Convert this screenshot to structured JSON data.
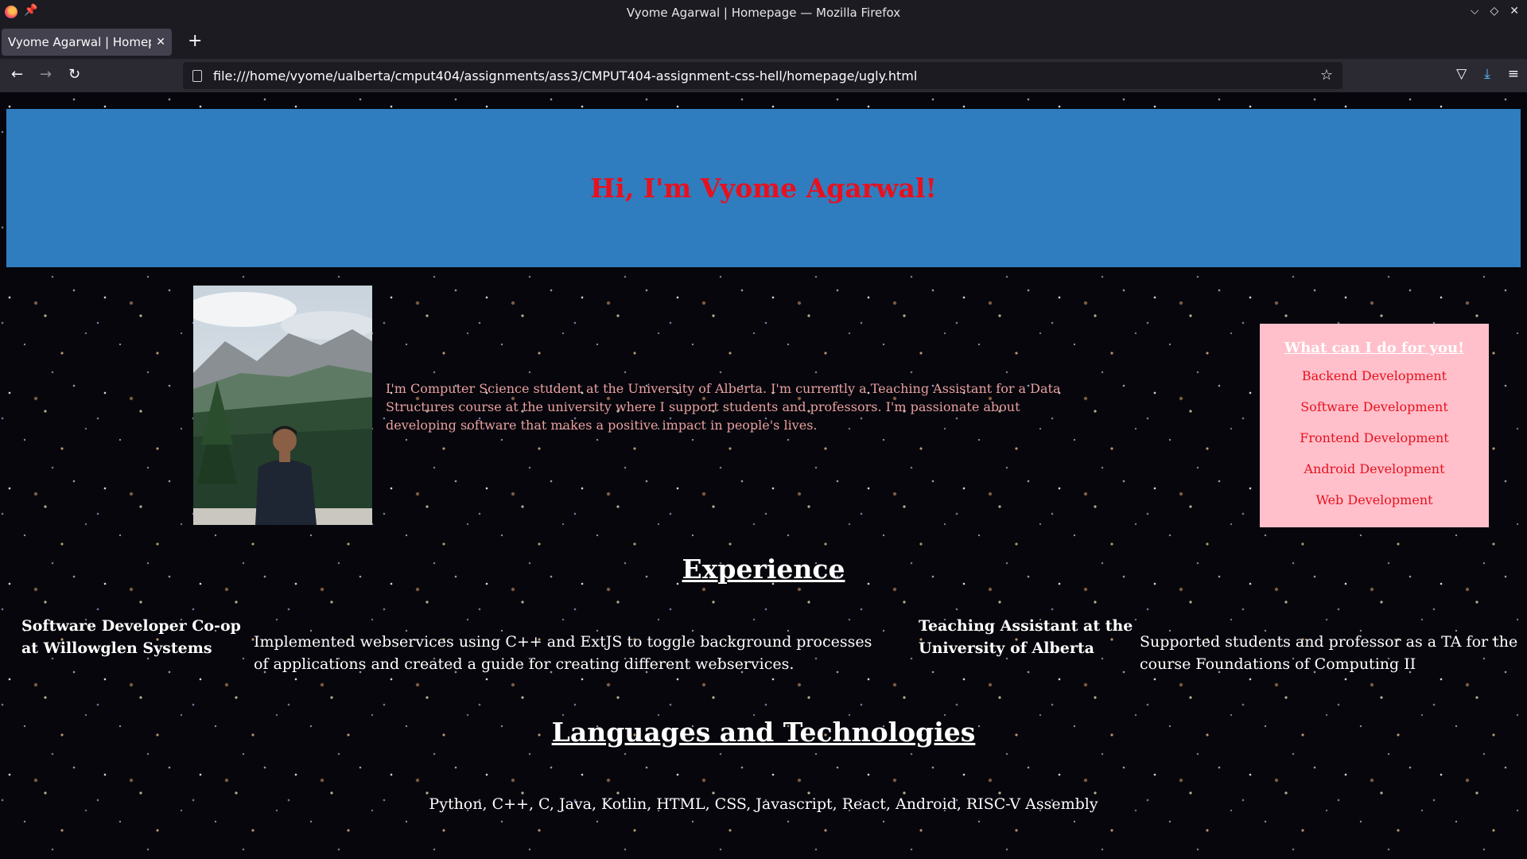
{
  "browser": {
    "window_title": "Vyome Agarwal | Homepage — Mozilla Firefox",
    "tab_title": "Vyome Agarwal | Homepage",
    "url": "file:///home/vyome/ualberta/cmput404/assignments/ass3/CMPUT404-assignment-css-hell/homepage/ugly.html"
  },
  "hero": {
    "heading": "Hi, I'm Vyome Agarwal!",
    "background_color": "#2f7dbf",
    "heading_color": "#e8101e"
  },
  "about": {
    "bio": "I'm Computer Science student at the University of Alberta. I'm currently a Teaching Assistant for a Data Structures course at the university where I support students and professors. I'm passionate about developing software that makes a positive impact in people's lives."
  },
  "services": {
    "title": "What can I do for you!",
    "items": [
      "Backend Development",
      "Software Development",
      "Frontend Development",
      "Android Development",
      "Web Development"
    ],
    "background_color": "#ffc0cb"
  },
  "experience": {
    "title": "Experience",
    "jobs": [
      {
        "role": "Software Developer Co-op at Willowglen Systems",
        "description": "Implemented webservices using C++ and ExtJS to toggle background processes of applications and created a guide for creating different webservices."
      },
      {
        "role": "Teaching Assistant at the University of Alberta",
        "description": "Supported students and professor as a TA for the course Foundations of Computing II"
      }
    ]
  },
  "languages": {
    "title": "Languages and Technologies",
    "list": "Python, C++, C, Java, Kotlin, HTML, CSS, Javascript, React, Android, RISC-V Assembly"
  }
}
